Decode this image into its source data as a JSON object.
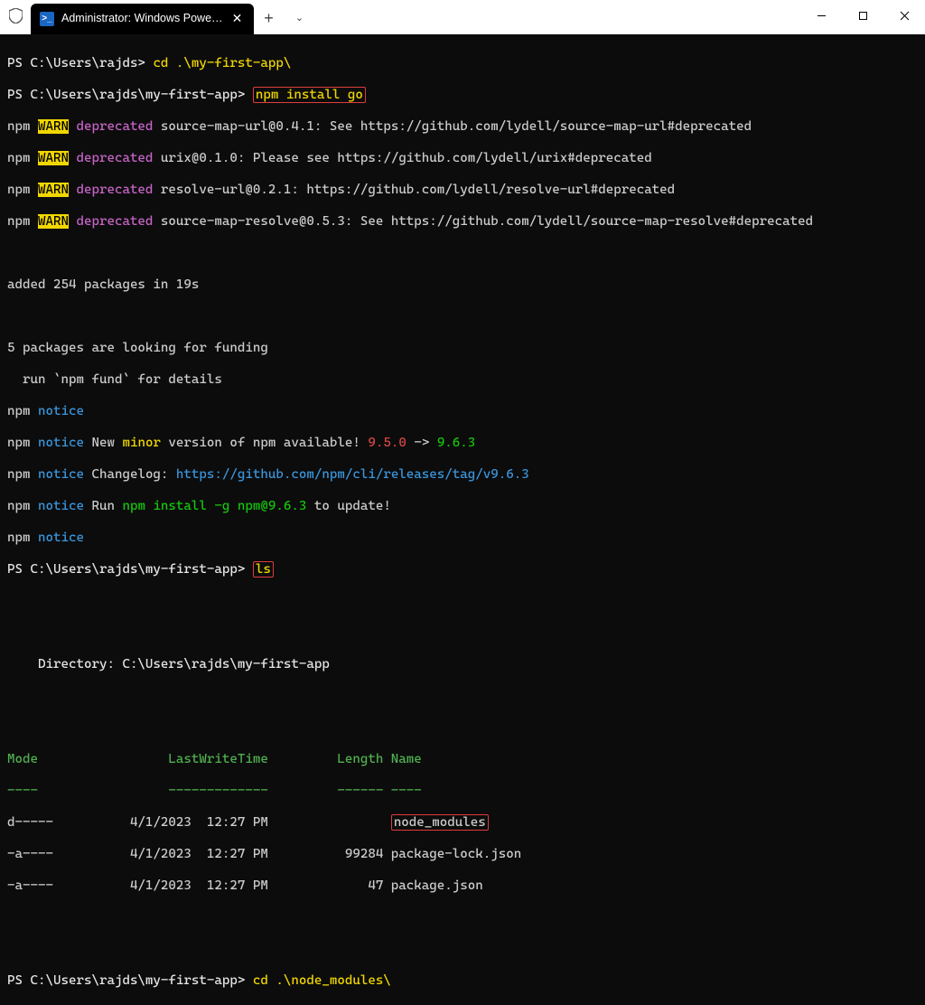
{
  "titlebar": {
    "tab_title": "Administrator: Windows Powe…",
    "new_tab_tip": "+",
    "dropdown_tip": "⌄",
    "min": "—",
    "max": "□",
    "close": "✕"
  },
  "lines": {
    "ps1_prompt": "PS C:\\Users\\rajds> ",
    "ps1_cmd": "cd .\\my-first-app\\",
    "ps2_prompt": "PS C:\\Users\\rajds\\my-first-app> ",
    "ps2_cmd": "npm install go",
    "w1_a": "npm ",
    "w1_b": "WARN",
    "w1_c": " deprecated",
    "w1_d": " source-map-url@0.4.1: See https://github.com/lydell/source-map-url#deprecated",
    "w2_d": " urix@0.1.0: Please see https://github.com/lydell/urix#deprecated",
    "w3_d": " resolve-url@0.2.1: https://github.com/lydell/resolve-url#deprecated",
    "w4_d": " source-map-resolve@0.5.3: See https://github.com/lydell/source-map-resolve#deprecated",
    "added": "added 254 packages in 19s",
    "fund1": "5 packages are looking for funding",
    "fund2": "  run `npm fund` for details",
    "n_npm": "npm ",
    "n_notice": "notice",
    "n2_a": " New ",
    "n2_b": "minor",
    "n2_c": " version of npm available! ",
    "n2_d": "9.5.0",
    "n2_e": " -> ",
    "n2_f": "9.6.3",
    "n3_a": " Changelog: ",
    "n3_b": "https://github.com/npm/cli/releases/tag/v9.6.3",
    "n4_a": " Run ",
    "n4_b": "npm install -g npm@9.6.3",
    "n4_c": " to update!",
    "ps3_cmd": "ls",
    "dir_line": "    Directory: C:\\Users\\rajds\\my-first-app",
    "hdr": "Mode                 LastWriteTime         Length Name",
    "sep": "----                 -------------         ------ ----",
    "row1": "d-----          4/1/2023  12:27 PM                ",
    "row1_name": "node_modules",
    "row2": "-a----          4/1/2023  12:27 PM          99284 package-lock.json",
    "row3": "-a----          4/1/2023  12:27 PM             47 package.json",
    "ps4_cmd": "cd .\\node_modules\\"
  },
  "chart_data": {
    "type": "table",
    "directory": "C:\\Users\\rajds\\my-first-app",
    "columns": [
      "Mode",
      "LastWriteTime",
      "Length",
      "Name"
    ],
    "rows": [
      {
        "Mode": "d-----",
        "LastWriteTime": "4/1/2023 12:27 PM",
        "Length": null,
        "Name": "node_modules"
      },
      {
        "Mode": "-a----",
        "LastWriteTime": "4/1/2023 12:27 PM",
        "Length": 99284,
        "Name": "package-lock.json"
      },
      {
        "Mode": "-a----",
        "LastWriteTime": "4/1/2023 12:27 PM",
        "Length": 47,
        "Name": "package.json"
      }
    ]
  }
}
